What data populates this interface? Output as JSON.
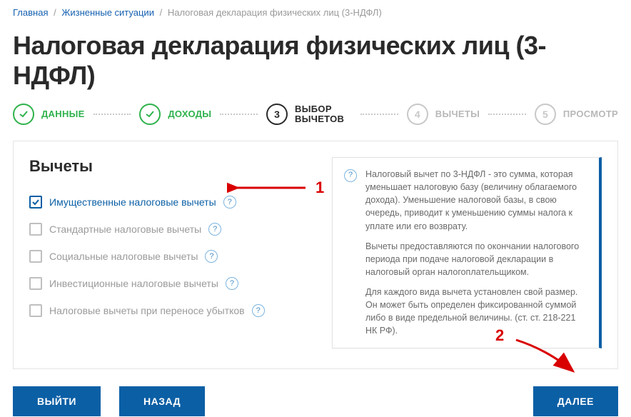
{
  "breadcrumb": {
    "home": "Главная",
    "level2": "Жизненные ситуации",
    "current": "Налоговая декларация физических лиц (3-НДФЛ)"
  },
  "title": "Налоговая декларация физических лиц (3-НДФЛ)",
  "steps": [
    {
      "label": "ДАННЫЕ",
      "state": "done"
    },
    {
      "label": "ДОХОДЫ",
      "state": "done"
    },
    {
      "label": "ВЫБОР ВЫЧЕТОВ",
      "num": "3",
      "state": "current"
    },
    {
      "label": "ВЫЧЕТЫ",
      "num": "4",
      "state": "pending"
    },
    {
      "label": "ПРОСМОТР",
      "num": "5",
      "state": "pending"
    }
  ],
  "section": {
    "title": "Вычеты"
  },
  "checkboxes": [
    {
      "label": "Имущественные налоговые вычеты",
      "checked": true
    },
    {
      "label": "Стандартные налоговые вычеты",
      "checked": false
    },
    {
      "label": "Социальные налоговые вычеты",
      "checked": false
    },
    {
      "label": "Инвестиционные налоговые вычеты",
      "checked": false
    },
    {
      "label": "Налоговые вычеты при переносе убытков",
      "checked": false
    }
  ],
  "info": {
    "p1": "Налоговый вычет по 3-НДФЛ - это сумма, которая уменьшает налоговую базу (величину облагаемого дохода). Уменьшение налоговой базы, в свою очередь, приводит к уменьшению суммы налога к уплате или его возврату.",
    "p2": "Вычеты предоставляются по окончании налогового периода при подаче налоговой декларации в налоговый орган налогоплательщиком.",
    "p3": "Для каждого вида вычета установлен свой размер. Он может быть определен фиксированной суммой либо в виде предельной величины. (ст. ст. 218-221 НК РФ)."
  },
  "buttons": {
    "exit": "ВЫЙТИ",
    "back": "НАЗАД",
    "next": "ДАЛЕЕ"
  },
  "annotations": {
    "a1": "1",
    "a2": "2"
  }
}
